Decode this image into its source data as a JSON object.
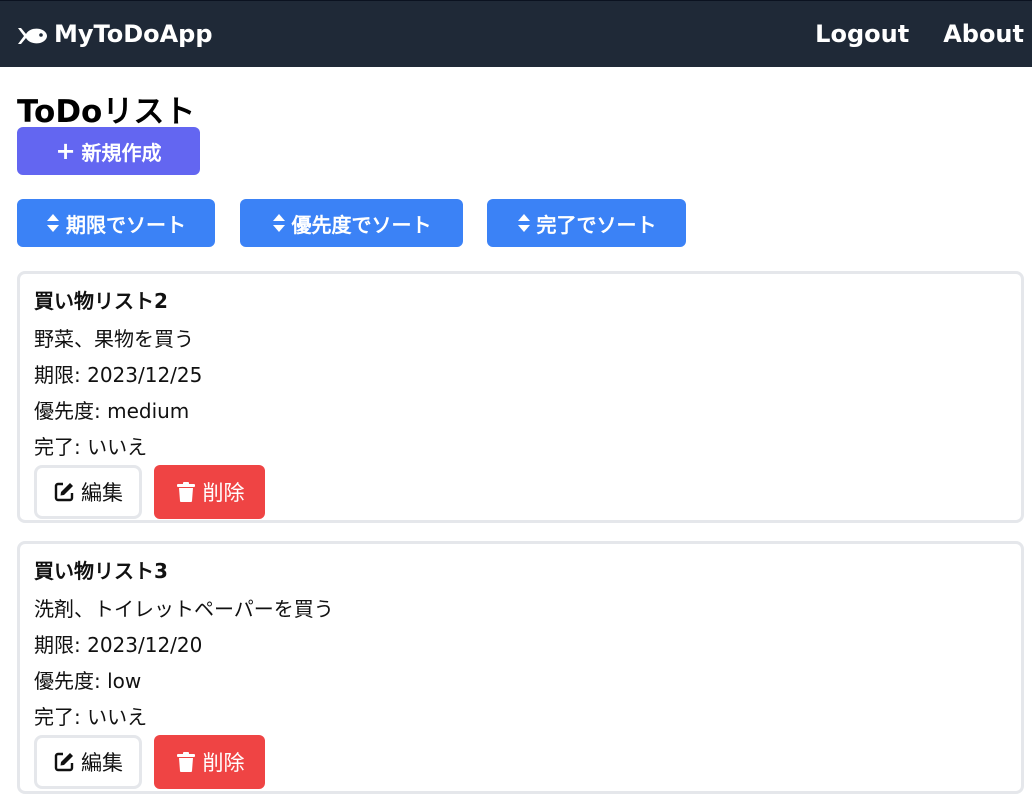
{
  "navbar": {
    "brand": "MyToDoApp",
    "brand_icon": "fish-icon",
    "links": [
      "Logout",
      "About"
    ],
    "bg_color": "#1f2937"
  },
  "page": {
    "title": "ToDoリスト",
    "new_button": "新規作成",
    "new_button_color": "#6366f1"
  },
  "sort_buttons": [
    {
      "label": "期限でソート",
      "icon": "sort-icon"
    },
    {
      "label": "優先度でソート",
      "icon": "sort-icon"
    },
    {
      "label": "完了でソート",
      "icon": "sort-icon"
    }
  ],
  "sort_button_color": "#3b82f6",
  "todos": [
    {
      "title": "買い物リスト2",
      "description": "野菜、果物を買う",
      "due": "期限: 2023/12/25",
      "priority": "優先度: medium",
      "done": "完了: いいえ",
      "edit_label": "編集",
      "delete_label": "削除"
    },
    {
      "title": "買い物リスト3",
      "description": "洗剤、トイレットペーパーを買う",
      "due": "期限: 2023/12/20",
      "priority": "優先度: low",
      "done": "完了: いいえ",
      "edit_label": "編集",
      "delete_label": "削除"
    }
  ],
  "delete_color": "#ef4444"
}
